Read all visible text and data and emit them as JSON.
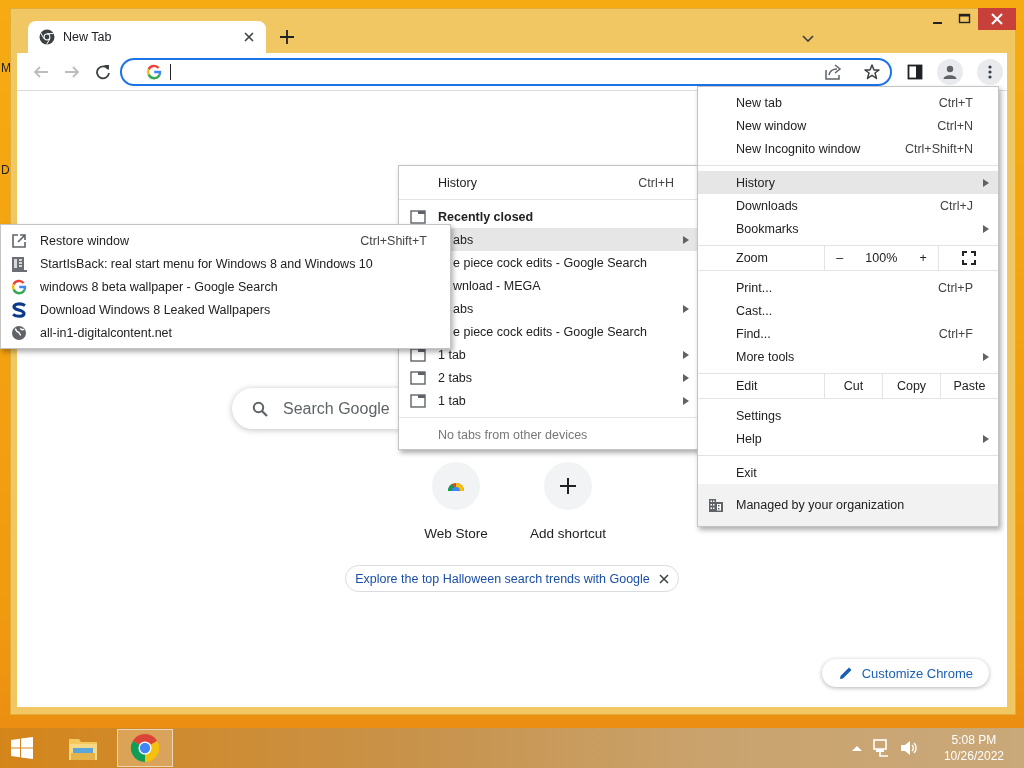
{
  "desktop": {
    "labels": [
      "M",
      "D"
    ]
  },
  "window": {
    "tabs": [
      {
        "title": "New Tab",
        "selected": true
      }
    ],
    "toolbar": {
      "nav": [
        {
          "kind": "back",
          "disabled": true
        },
        {
          "kind": "forward",
          "disabled": true
        },
        {
          "kind": "reload",
          "disabled": false
        }
      ]
    },
    "page": {
      "search": {
        "placeholder": "Search Google"
      },
      "shortcuts": [
        {
          "kind": "store",
          "label": "Web Store"
        },
        {
          "kind": "add",
          "label": "Add shortcut"
        }
      ],
      "promo": "Explore the top Halloween search trends with Google",
      "customize": "Customize Chrome"
    }
  },
  "app_menu": {
    "items": [
      {
        "kind": "item",
        "label": "New tab",
        "shortcut": "Ctrl+T",
        "submenu": false,
        "selected": false
      },
      {
        "kind": "item",
        "label": "New window",
        "shortcut": "Ctrl+N",
        "submenu": false,
        "selected": false
      },
      {
        "kind": "item",
        "label": "New Incognito window",
        "shortcut": "Ctrl+Shift+N",
        "submenu": false,
        "selected": false
      },
      {
        "kind": "separator"
      },
      {
        "kind": "item",
        "label": "History",
        "submenu": true,
        "selected": true
      },
      {
        "kind": "item",
        "label": "Downloads",
        "shortcut": "Ctrl+J",
        "submenu": false,
        "selected": false
      },
      {
        "kind": "item",
        "label": "Bookmarks",
        "submenu": true,
        "selected": false
      },
      {
        "kind": "zoom",
        "label": "Zoom",
        "minus": "–",
        "value": "100%",
        "plus": "+"
      },
      {
        "kind": "item",
        "label": "Print...",
        "shortcut": "Ctrl+P",
        "submenu": false,
        "selected": false
      },
      {
        "kind": "item",
        "label": "Cast...",
        "submenu": false,
        "selected": false
      },
      {
        "kind": "item",
        "label": "Find...",
        "shortcut": "Ctrl+F",
        "submenu": false,
        "selected": false
      },
      {
        "kind": "item",
        "label": "More tools",
        "submenu": true,
        "selected": false
      },
      {
        "kind": "edit",
        "label": "Edit",
        "buttons": [
          "Cut",
          "Copy",
          "Paste"
        ]
      },
      {
        "kind": "item",
        "label": "Settings",
        "submenu": false,
        "selected": false
      },
      {
        "kind": "item",
        "label": "Help",
        "submenu": true,
        "selected": false
      },
      {
        "kind": "separator"
      },
      {
        "kind": "item",
        "label": "Exit",
        "submenu": false,
        "selected": false
      },
      {
        "kind": "managed",
        "label": "Managed by your organization"
      }
    ]
  },
  "history_menu": {
    "items": [
      {
        "kind": "item",
        "label": "History",
        "shortcut": "Ctrl+H",
        "submenu": false,
        "selected": false
      },
      {
        "kind": "separator"
      },
      {
        "kind": "section",
        "label": "Recently closed"
      },
      {
        "kind": "covered",
        "label": "abs",
        "submenu": true,
        "selected": true
      },
      {
        "kind": "covered",
        "label": "e piece cock edits - Google Search",
        "submenu": false,
        "selected": false
      },
      {
        "kind": "covered",
        "label": "wnload - MEGA",
        "submenu": false,
        "selected": false
      },
      {
        "kind": "covered",
        "label": "abs",
        "submenu": true,
        "selected": false
      },
      {
        "kind": "covered",
        "label": "e piece cock edits - Google Search",
        "submenu": false,
        "selected": false
      },
      {
        "kind": "window",
        "label": "1 tab",
        "submenu": true,
        "selected": false
      },
      {
        "kind": "window",
        "label": "2 tabs",
        "submenu": true,
        "selected": false
      },
      {
        "kind": "window",
        "label": "1 tab",
        "submenu": true,
        "selected": false
      },
      {
        "kind": "separator"
      },
      {
        "kind": "note",
        "label": "No tabs from other devices"
      }
    ]
  },
  "window_submenu": {
    "items": [
      {
        "kind": "restore",
        "label": "Restore window",
        "shortcut": "Ctrl+Shift+T",
        "submenu": false,
        "selected": false
      },
      {
        "kind": "page",
        "label": "StartIsBack: real start menu for Windows 8 and Windows 10",
        "submenu": false,
        "selected": false
      },
      {
        "kind": "google",
        "label": "windows 8 beta wallpaper - Google Search",
        "submenu": false,
        "selected": false
      },
      {
        "kind": "logo",
        "label": "Download Windows 8 Leaked Wallpapers",
        "submenu": false,
        "selected": false
      },
      {
        "kind": "globe",
        "label": "all-in1-digitalcontent.net",
        "submenu": false,
        "selected": false
      }
    ]
  },
  "taskbar": {
    "apps": [
      {
        "kind": "explorer",
        "selected": false
      },
      {
        "kind": "chrome",
        "selected": true
      }
    ],
    "clock": {
      "time": "5:08 PM",
      "date": "10/26/2022"
    }
  }
}
